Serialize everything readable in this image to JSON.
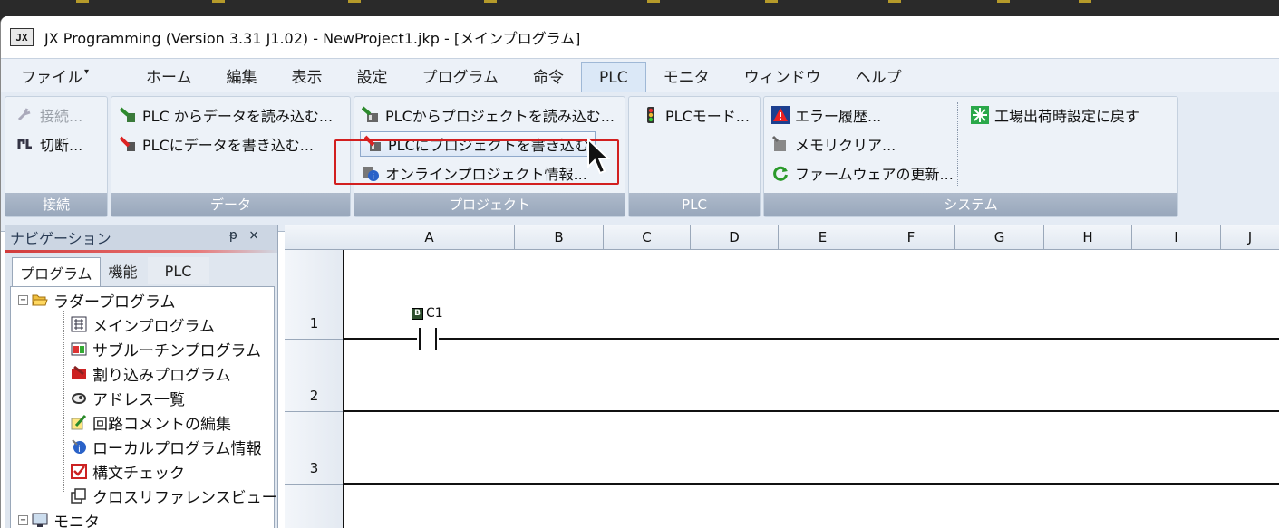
{
  "window": {
    "app_icon_text": "JX",
    "title": "JX Programming (Version 3.31 J1.02) - NewProject1.jkp - [メインプログラム]"
  },
  "menubar": {
    "items": [
      "ファイル",
      "ホーム",
      "編集",
      "表示",
      "設定",
      "プログラム",
      "命令",
      "PLC",
      "モニタ",
      "ウィンドウ",
      "ヘルプ"
    ],
    "active": "PLC"
  },
  "ribbon": {
    "groups": [
      {
        "label": "接続",
        "buttons": [
          {
            "label": "接続...",
            "icon": "connect-icon",
            "enabled": false
          },
          {
            "label": "切断...",
            "icon": "disconnect-icon",
            "enabled": true
          }
        ]
      },
      {
        "label": "データ",
        "buttons": [
          {
            "label": "PLC からデータを読み込む...",
            "icon": "read-data-icon"
          },
          {
            "label": "PLCにデータを書き込む...",
            "icon": "write-data-icon"
          }
        ]
      },
      {
        "label": "プロジェクト",
        "buttons": [
          {
            "label": "PLCからプロジェクトを読み込む...",
            "icon": "read-project-icon"
          },
          {
            "label": "PLCにプロジェクトを書き込む",
            "icon": "write-project-icon",
            "hovered": true
          },
          {
            "label": "オンラインプロジェクト情報...",
            "icon": "online-info-icon"
          }
        ]
      },
      {
        "label": "PLC",
        "buttons": [
          {
            "label": "PLCモード...",
            "icon": "traffic-light-icon"
          }
        ]
      },
      {
        "label": "システム",
        "buttons": [
          {
            "label": "エラー履歴...",
            "icon": "warning-icon"
          },
          {
            "label": "メモリクリア...",
            "icon": "memory-clear-icon"
          },
          {
            "label": "ファームウェアの更新...",
            "icon": "refresh-icon"
          },
          {
            "label": "工場出荷時設定に戻す",
            "icon": "factory-reset-icon"
          }
        ]
      }
    ]
  },
  "navigation": {
    "title": "ナビゲーション",
    "pin_glyph": "ᵽ",
    "close_glyph": "×",
    "tabs": [
      "プログラム",
      "機能",
      "PLC"
    ],
    "active_tab": "プログラム",
    "tree": {
      "root": "ラダープログラム",
      "children": [
        "メインプログラム",
        "サブルーチンプログラム",
        "割り込みプログラム",
        "アドレス一覧",
        "回路コメントの編集",
        "ローカルプログラム情報",
        "構文チェック",
        "クロスリファレンスビュー"
      ],
      "next_root": "モニタ"
    }
  },
  "ladder": {
    "columns": [
      "A",
      "B",
      "C",
      "D",
      "E",
      "F",
      "G",
      "H",
      "I",
      "J"
    ],
    "rows": [
      "1",
      "2",
      "3"
    ],
    "contact": {
      "badge": "B",
      "label": "C1"
    }
  },
  "colors": {
    "accent_red": "#d21f1f",
    "ribbon_bg": "#e4ebf4",
    "group_label_bg": "#a5b2c5"
  }
}
